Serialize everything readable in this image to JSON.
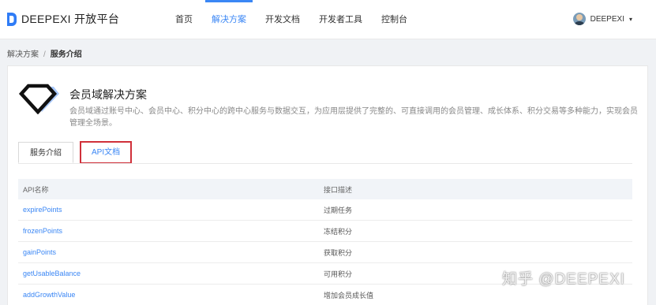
{
  "header": {
    "brand": "DEEPEXI 开放平台",
    "nav": [
      "首页",
      "解决方案",
      "开发文档",
      "开发者工具",
      "控制台"
    ],
    "active_nav_index": 1,
    "user": {
      "name": "DEEPEXI",
      "caret": "▾"
    }
  },
  "breadcrumb": {
    "parent": "解决方案",
    "separator": "/",
    "current": "服务介绍"
  },
  "product": {
    "title": "会员域解决方案",
    "description": "会员域通过账号中心、会员中心、积分中心的跨中心服务与数据交互，为应用层提供了完整的、可直接调用的会员管理、成长体系、积分交易等多种能力，实现会员管理全场景。"
  },
  "tabs": [
    "服务介绍",
    "API文档"
  ],
  "active_tab_index": 1,
  "table": {
    "headers": [
      "API名称",
      "接口描述"
    ],
    "rows": [
      {
        "name": "expirePoints",
        "desc": "过期任务"
      },
      {
        "name": "frozenPoints",
        "desc": "冻结积分"
      },
      {
        "name": "gainPoints",
        "desc": "获取积分"
      },
      {
        "name": "getUsableBalance",
        "desc": "可用积分"
      },
      {
        "name": "addGrowthValue",
        "desc": "增加会员成长值"
      }
    ]
  },
  "watermark": "知乎 @DEEPEXI",
  "colors": {
    "accent": "#3b87f5",
    "highlight_border": "#d0303a"
  }
}
